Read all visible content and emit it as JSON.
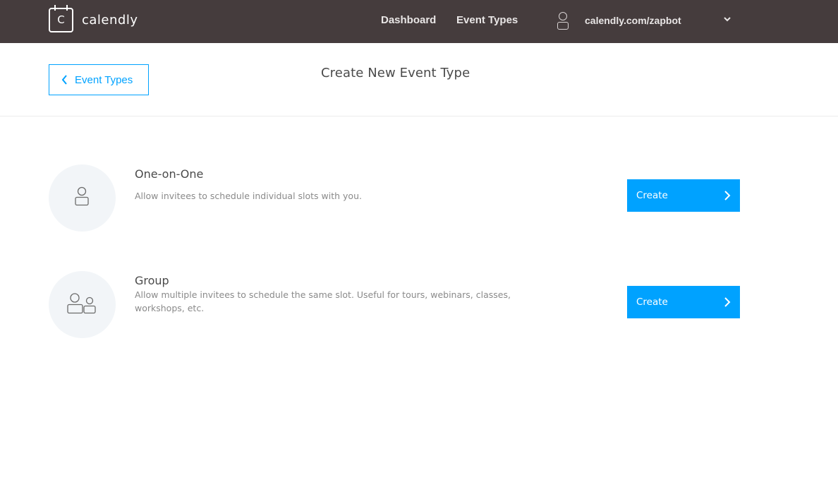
{
  "brand": {
    "logo_letter": "C",
    "name": "calendly"
  },
  "nav": {
    "dashboard": "Dashboard",
    "event_types": "Event Types",
    "user_url": "calendly.com/zapbot"
  },
  "header": {
    "back_label": "Event Types",
    "title": "Create New Event Type"
  },
  "events": [
    {
      "title": "One-on-One",
      "description": "Allow invitees to schedule individual slots with you.",
      "button": "Create",
      "icon": "single-person-icon"
    },
    {
      "title": "Group",
      "description": "Allow multiple invitees to schedule the same slot. Useful for tours, webinars, classes, workshops, etc.",
      "button": "Create",
      "icon": "group-people-icon"
    }
  ],
  "colors": {
    "topbar": "#453c3d",
    "accent": "#00a2ff",
    "icon_circle": "#f2f5f8"
  }
}
